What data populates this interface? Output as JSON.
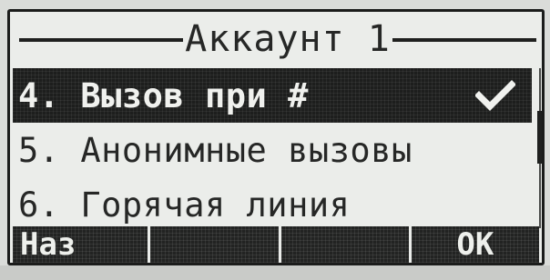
{
  "screen": {
    "title": "Аккаунт 1"
  },
  "menu": {
    "items": [
      {
        "label": "4. Вызов при #",
        "selected": true,
        "checked": true
      },
      {
        "label": "5. Анонимные вызовы",
        "selected": false,
        "checked": false
      },
      {
        "label": "6. Горячая линия",
        "selected": false,
        "checked": false
      }
    ]
  },
  "scrollbar": {
    "position_fraction": 0.4
  },
  "softkeys": {
    "key1": "Наз",
    "key2": "",
    "key3": "",
    "key4": "ОК"
  },
  "icons": {
    "check": "check-icon"
  },
  "colors": {
    "screen_bg": "#ebedea",
    "pixel_dark": "#1d1e1d",
    "pixel_light": "#f0f1ee"
  }
}
